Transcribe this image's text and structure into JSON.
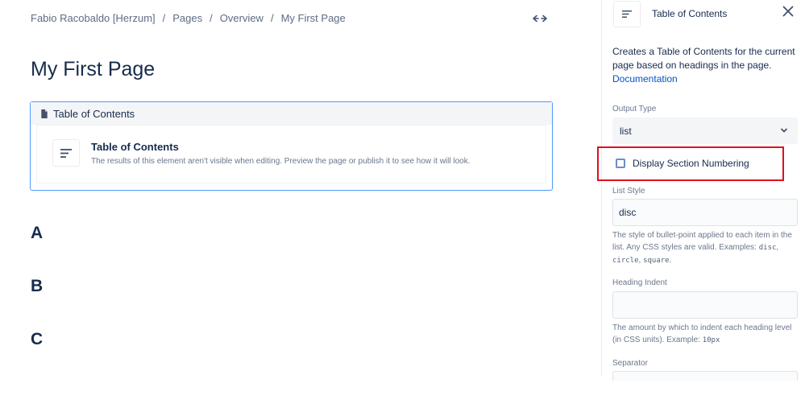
{
  "breadcrumb": {
    "items": [
      "Fabio Racobaldo [Herzum]",
      "Pages",
      "Overview",
      "My First Page"
    ],
    "separator": "/"
  },
  "editor": {
    "title": "My First Page",
    "macro": {
      "header_label": "Table of Contents",
      "body_title": "Table of Contents",
      "body_description": "The results of this element aren't visible when editing. Preview the page or publish it to see how it will look."
    },
    "headings": [
      "A",
      "B",
      "C"
    ]
  },
  "panel": {
    "title": "Table of Contents",
    "description": "Creates a Table of Contents for the current page based on headings in the page.",
    "doc_link": "Documentation",
    "output_type": {
      "label": "Output Type",
      "value": "list"
    },
    "section_numbering": {
      "label": "Display Section Numbering",
      "checked": false
    },
    "list_style": {
      "label": "List Style",
      "value": "disc",
      "helper_prefix": "The style of bullet-point applied to each item in the list. Any CSS styles are valid. Examples: ",
      "examples": [
        "disc",
        "circle",
        "square"
      ],
      "ex_sep1": ", ",
      "ex_sep2": ", ",
      "ex_end": "."
    },
    "heading_indent": {
      "label": "Heading Indent",
      "value": "",
      "helper_prefix": "The amount by which to indent each heading level (in CSS units). Example: ",
      "example": "10px"
    },
    "separator": {
      "label": "Separator"
    }
  },
  "colors": {
    "accent": "#0052cc",
    "highlight": "#e0101e",
    "macro_border": "#4c9aff"
  }
}
